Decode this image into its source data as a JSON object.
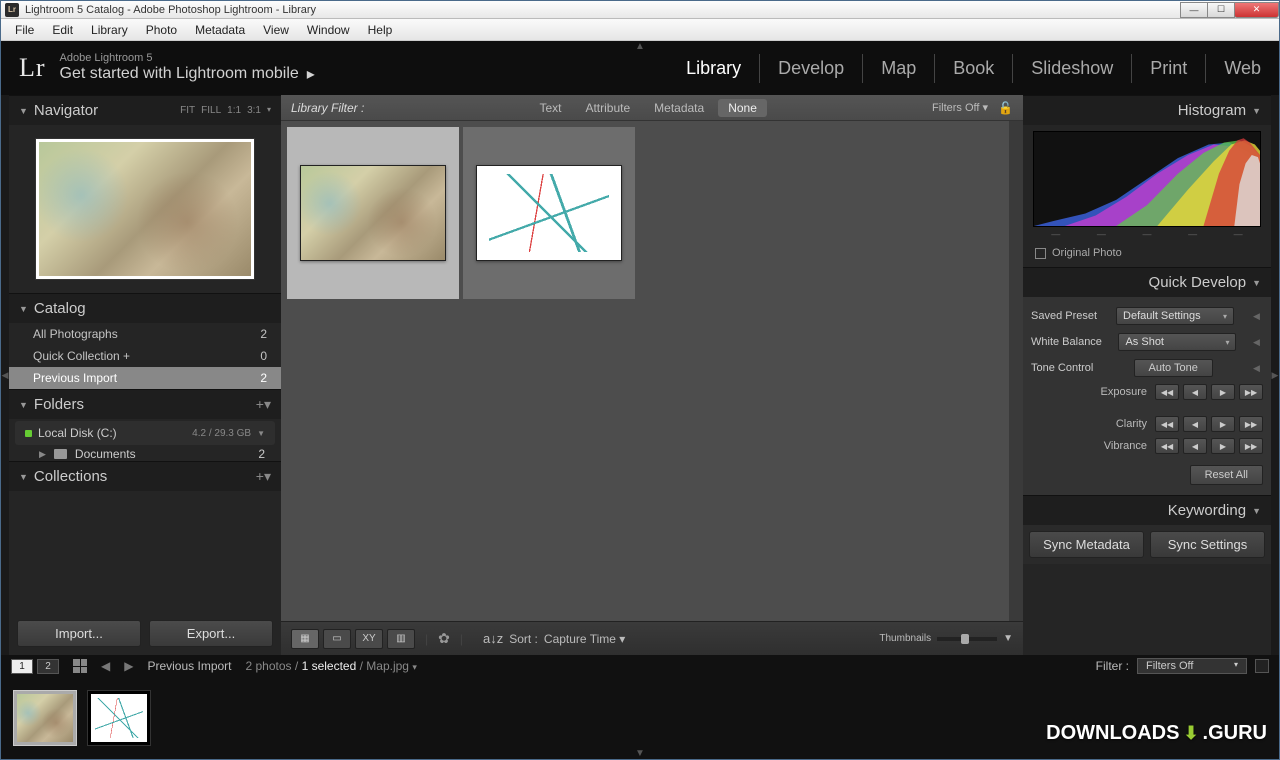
{
  "window": {
    "title": "Lightroom 5 Catalog - Adobe Photoshop Lightroom - Library"
  },
  "menu": [
    "File",
    "Edit",
    "Library",
    "Photo",
    "Metadata",
    "View",
    "Window",
    "Help"
  ],
  "identity": {
    "logo": "Lr",
    "sub": "Adobe Lightroom 5",
    "main": "Get started with Lightroom mobile"
  },
  "modules": [
    "Library",
    "Develop",
    "Map",
    "Book",
    "Slideshow",
    "Print",
    "Web"
  ],
  "active_module": "Library",
  "navigator": {
    "title": "Navigator",
    "ratios": [
      "FIT",
      "FILL",
      "1:1",
      "3:1"
    ]
  },
  "catalog": {
    "title": "Catalog",
    "items": [
      {
        "label": "All Photographs",
        "count": "2"
      },
      {
        "label": "Quick Collection  +",
        "count": "0"
      },
      {
        "label": "Previous Import",
        "count": "2"
      }
    ],
    "selected_index": 2
  },
  "folders": {
    "title": "Folders",
    "disk": {
      "name": "Local Disk (C:)",
      "stat": "4.2 / 29.3 GB"
    },
    "documents": {
      "label": "Documents",
      "count": "2"
    }
  },
  "collections": {
    "title": "Collections"
  },
  "left_buttons": {
    "import": "Import...",
    "export": "Export..."
  },
  "library_filter": {
    "label": "Library Filter :",
    "tabs": [
      "Text",
      "Attribute",
      "Metadata",
      "None"
    ],
    "active": "None",
    "filters_off": "Filters Off"
  },
  "toolbar": {
    "sort_label": "Sort :",
    "sort_value": "Capture Time",
    "thumbnails_label": "Thumbnails"
  },
  "right": {
    "histogram": "Histogram",
    "original_photo": "Original Photo",
    "quick_develop": "Quick Develop",
    "saved_preset": {
      "label": "Saved Preset",
      "value": "Default Settings"
    },
    "white_balance": {
      "label": "White Balance",
      "value": "As Shot"
    },
    "tone_control": {
      "label": "Tone Control",
      "auto": "Auto Tone"
    },
    "exposure": "Exposure",
    "clarity": "Clarity",
    "vibrance": "Vibrance",
    "reset_all": "Reset All",
    "keywording": "Keywording",
    "sync_metadata": "Sync Metadata",
    "sync_settings": "Sync Settings"
  },
  "status": {
    "pages": [
      "1",
      "2"
    ],
    "source": "Previous Import",
    "count": "2 photos /",
    "selected": "1 selected",
    "file": " / Map.jpg",
    "filter_label": "Filter :",
    "filter_value": "Filters Off"
  },
  "watermark": {
    "left": "DOWNLOADS",
    "right": ".GURU"
  }
}
